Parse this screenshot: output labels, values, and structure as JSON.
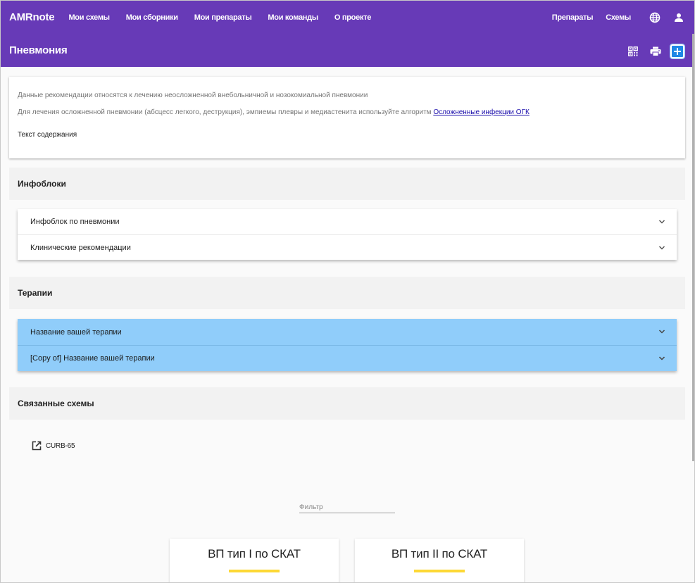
{
  "app": {
    "brand": "AMRnote"
  },
  "nav": {
    "left": [
      "Мои схемы",
      "Мои сборники",
      "Мои препараты",
      "Мои команды",
      "О проекте"
    ],
    "right": [
      "Препараты",
      "Схемы"
    ]
  },
  "header": {
    "title": "Пневмония"
  },
  "intro": {
    "line1": "Данные рекомендации относятся к лечению неосложненной внебольничной и нозокомиальной пневмонии",
    "line2_text": "Для лечения осложненной пневмонии (абсцесс легкого, деструкция), эмпиемы плевры и медиастенита используйте алгоритм ",
    "line2_link": "Осложненные инфекции ОГК",
    "line3": "Текст содержания"
  },
  "infoblocks": {
    "heading": "Инфоблоки",
    "items": [
      "Инфоблок по пневмонии",
      "Клинические рекомендации"
    ]
  },
  "therapies": {
    "heading": "Терапии",
    "items": [
      "Название вашей терапии",
      "[Copy of] Название вашей терапии"
    ]
  },
  "related": {
    "heading": "Связанные схемы",
    "items": [
      "CURB-65"
    ]
  },
  "filter": {
    "placeholder": "Фильтр",
    "value": ""
  },
  "cards": [
    {
      "title": "ВП тип I по СКАТ"
    },
    {
      "title": "ВП тип II по СКАТ"
    }
  ],
  "colors": {
    "primary": "#673ab7",
    "therapy_bg": "#90cdfa",
    "card_accent": "#fdd835",
    "link": "#1a0dab"
  }
}
